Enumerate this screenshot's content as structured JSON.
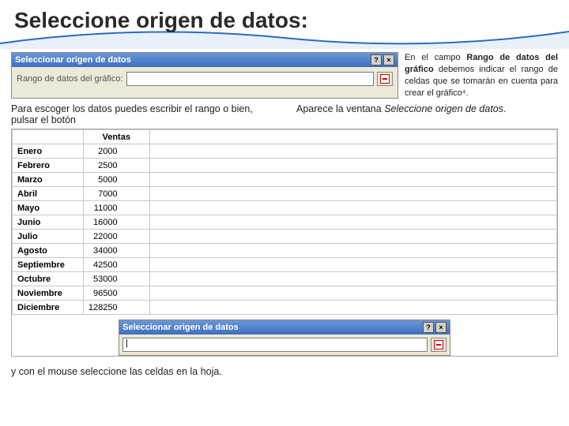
{
  "title": "Seleccione origen de datos:",
  "dialog1": {
    "title": "Seleccionar origen de datos",
    "help": "?",
    "close": "×",
    "label": "Rango de datos del gráfico:"
  },
  "top_right_text_pre": "En el campo ",
  "top_right_text_bold": "Rango de datos del gráfico",
  "top_right_text_post": " debemos indicar el rango de celdas que se tomarán en cuenta para crear el gráfico⁴.",
  "mid_left": "Para escoger los datos puedes escribir el rango o bien, pulsar el botón",
  "mid_right_pre": "Aparece la ventana ",
  "mid_right_italic": "Seleccione origen de datos",
  "mid_right_post": ".",
  "sheet": {
    "header_b": "Ventas",
    "rows": [
      {
        "m": "Enero",
        "v": "2000"
      },
      {
        "m": "Febrero",
        "v": "2500"
      },
      {
        "m": "Marzo",
        "v": "5000"
      },
      {
        "m": "Abril",
        "v": "7000"
      },
      {
        "m": "Mayo",
        "v": "11000"
      },
      {
        "m": "Junio",
        "v": "16000"
      },
      {
        "m": "Julio",
        "v": "22000"
      },
      {
        "m": "Agosto",
        "v": "34000"
      },
      {
        "m": "Septiembre",
        "v": "42500"
      },
      {
        "m": "Octubre",
        "v": "53000"
      },
      {
        "m": "Noviembre",
        "v": "96500"
      },
      {
        "m": "Diciembre",
        "v": "128250"
      }
    ]
  },
  "dialog2": {
    "title": "Seleccionar origen de datos",
    "help": "?",
    "close": "×",
    "cursor": "|"
  },
  "bottom_text": "y con el mouse seleccione las celdas en la hoja."
}
